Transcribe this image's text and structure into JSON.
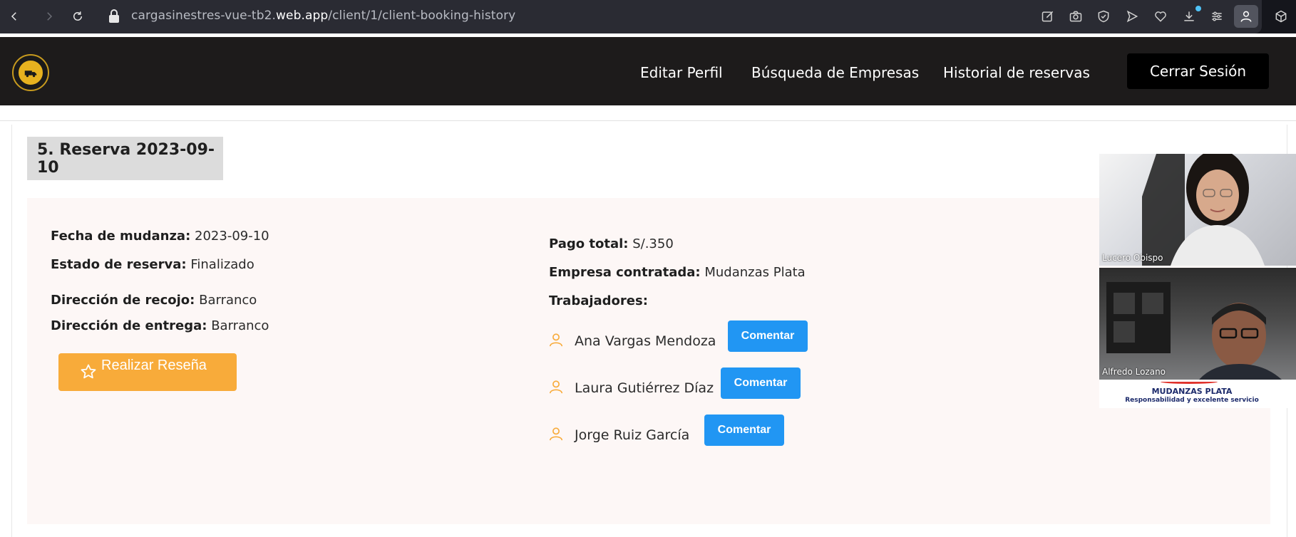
{
  "browser": {
    "url_prefix": "cargasinestres-vue-tb2.",
    "url_host": "web.app",
    "url_path": "/client/1/client-booking-history"
  },
  "header": {
    "nav": [
      "Editar Perfil",
      "Búsqueda de Empresas",
      "Historial de reservas"
    ],
    "logout_label": "Cerrar Sesión"
  },
  "reservation": {
    "title": "5. Reserva 2023-09-10",
    "fecha_label": "Fecha de mudanza:",
    "fecha_value": "2023-09-10",
    "estado_label": "Estado de reserva:",
    "estado_value": "Finalizado",
    "recojo_label": "Dirección de recojo:",
    "recojo_value": "Barranco",
    "entrega_label": "Dirección de entrega:",
    "entrega_value": "Barranco",
    "review_label": "Realizar Reseña",
    "pago_label": "Pago total:",
    "pago_value": "S/.350",
    "empresa_label": "Empresa contratada:",
    "empresa_value": "Mudanzas Plata",
    "trabajadores_label": "Trabajadores:",
    "workers": [
      {
        "name": "Ana Vargas Mendoza",
        "action": "Comentar"
      },
      {
        "name": "Laura Gutiérrez Díaz",
        "action": "Comentar"
      },
      {
        "name": "Jorge Ruiz García",
        "action": "Comentar"
      }
    ]
  },
  "video": {
    "participants": [
      "Lucero Obispo",
      "Alfredo Lozano"
    ],
    "banner_title": "MUDANZAS PLATA",
    "banner_subtitle": "Responsabilidad y excelente servicio"
  },
  "colors": {
    "accent_orange": "#f8ab3a",
    "button_blue": "#2196f3",
    "header_bg": "#1d1b1b",
    "card_bg": "#fdf7f6"
  }
}
